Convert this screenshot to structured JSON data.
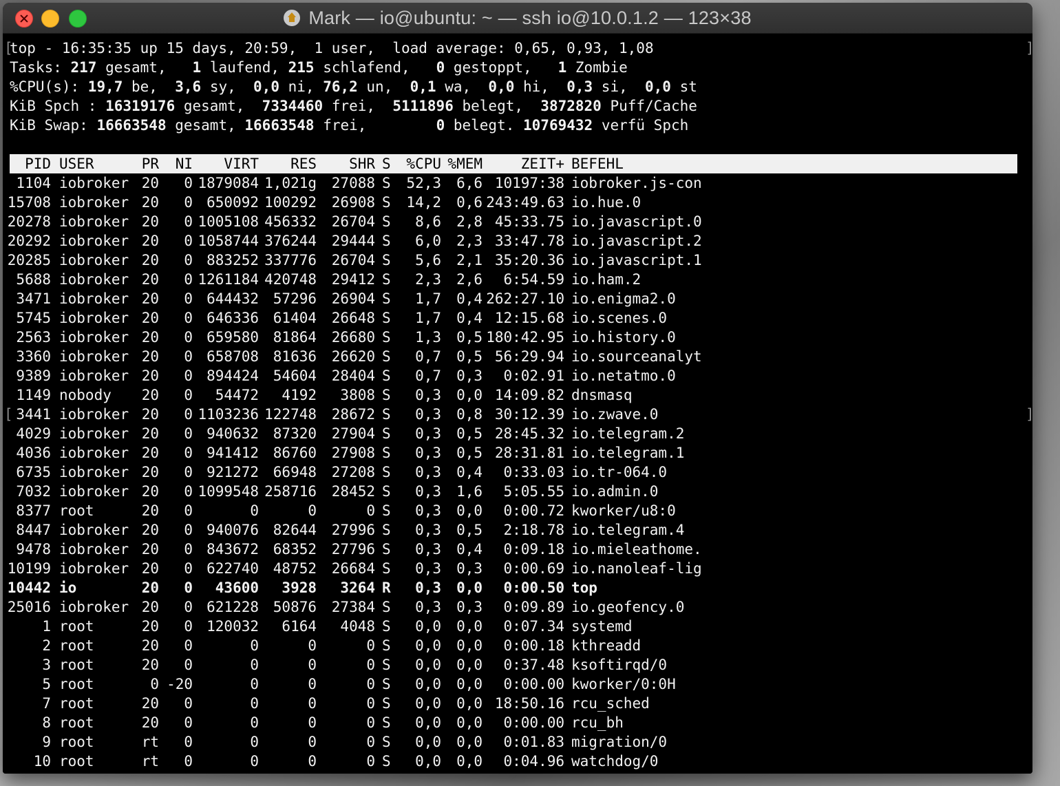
{
  "window": {
    "title": "Mark — io@ubuntu: ~ — ssh io@10.0.1.2 — 123×38",
    "icon": "home-icon"
  },
  "summary": [
    {
      "parts": [
        {
          "t": "top - 16:35:35 up 15 days, 20:59,  1 user,  load average: 0,65, 0,93, 1,08",
          "b": false
        }
      ]
    },
    {
      "parts": [
        {
          "t": "Tasks: ",
          "b": false
        },
        {
          "t": "217",
          "b": true
        },
        {
          "t": " gesamt,   ",
          "b": false
        },
        {
          "t": "1",
          "b": true
        },
        {
          "t": " laufend, ",
          "b": false
        },
        {
          "t": "215",
          "b": true
        },
        {
          "t": " schlafend,   ",
          "b": false
        },
        {
          "t": "0",
          "b": true
        },
        {
          "t": " gestoppt,   ",
          "b": false
        },
        {
          "t": "1",
          "b": true
        },
        {
          "t": " Zombie",
          "b": false
        }
      ]
    },
    {
      "parts": [
        {
          "t": "%CPU(s): ",
          "b": false
        },
        {
          "t": "19,7",
          "b": true
        },
        {
          "t": " be,  ",
          "b": false
        },
        {
          "t": "3,6",
          "b": true
        },
        {
          "t": " sy,  ",
          "b": false
        },
        {
          "t": "0,0",
          "b": true
        },
        {
          "t": " ni, ",
          "b": false
        },
        {
          "t": "76,2",
          "b": true
        },
        {
          "t": " un,  ",
          "b": false
        },
        {
          "t": "0,1",
          "b": true
        },
        {
          "t": " wa,  ",
          "b": false
        },
        {
          "t": "0,0",
          "b": true
        },
        {
          "t": " hi,  ",
          "b": false
        },
        {
          "t": "0,3",
          "b": true
        },
        {
          "t": " si,  ",
          "b": false
        },
        {
          "t": "0,0",
          "b": true
        },
        {
          "t": " st",
          "b": false
        }
      ]
    },
    {
      "parts": [
        {
          "t": "KiB Spch : ",
          "b": false
        },
        {
          "t": "16319176",
          "b": true
        },
        {
          "t": " gesamt,  ",
          "b": false
        },
        {
          "t": "7334460",
          "b": true
        },
        {
          "t": " frei,  ",
          "b": false
        },
        {
          "t": "5111896",
          "b": true
        },
        {
          "t": " belegt,  ",
          "b": false
        },
        {
          "t": "3872820",
          "b": true
        },
        {
          "t": " Puff/Cache",
          "b": false
        }
      ]
    },
    {
      "parts": [
        {
          "t": "KiB Swap: ",
          "b": false
        },
        {
          "t": "16663548",
          "b": true
        },
        {
          "t": " gesamt, ",
          "b": false
        },
        {
          "t": "16663548",
          "b": true
        },
        {
          "t": " frei,        ",
          "b": false
        },
        {
          "t": "0",
          "b": true
        },
        {
          "t": " belegt. ",
          "b": false
        },
        {
          "t": "10769432",
          "b": true
        },
        {
          "t": " verfü Spch",
          "b": false
        }
      ]
    }
  ],
  "columns": [
    "PID",
    "USER",
    "PR",
    "NI",
    "VIRT",
    "RES",
    "SHR",
    "S",
    "%CPU",
    "%MEM",
    "ZEIT+",
    "BEFEHL"
  ],
  "processes": [
    {
      "pid": "1104",
      "user": "iobroker",
      "pr": "20",
      "ni": "0",
      "virt": "1879084",
      "res": "1,021g",
      "shr": "27088",
      "s": "S",
      "cpu": "52,3",
      "mem": "6,6",
      "time": "10197:38",
      "cmd": "iobroker.js-con"
    },
    {
      "pid": "15708",
      "user": "iobroker",
      "pr": "20",
      "ni": "0",
      "virt": "650092",
      "res": "100292",
      "shr": "26908",
      "s": "S",
      "cpu": "14,2",
      "mem": "0,6",
      "time": "243:49.63",
      "cmd": "io.hue.0"
    },
    {
      "pid": "20278",
      "user": "iobroker",
      "pr": "20",
      "ni": "0",
      "virt": "1005108",
      "res": "456332",
      "shr": "26704",
      "s": "S",
      "cpu": "8,6",
      "mem": "2,8",
      "time": "45:33.75",
      "cmd": "io.javascript.0"
    },
    {
      "pid": "20292",
      "user": "iobroker",
      "pr": "20",
      "ni": "0",
      "virt": "1058744",
      "res": "376244",
      "shr": "29444",
      "s": "S",
      "cpu": "6,0",
      "mem": "2,3",
      "time": "33:47.78",
      "cmd": "io.javascript.2"
    },
    {
      "pid": "20285",
      "user": "iobroker",
      "pr": "20",
      "ni": "0",
      "virt": "883252",
      "res": "337776",
      "shr": "26704",
      "s": "S",
      "cpu": "5,6",
      "mem": "2,1",
      "time": "35:20.36",
      "cmd": "io.javascript.1"
    },
    {
      "pid": "5688",
      "user": "iobroker",
      "pr": "20",
      "ni": "0",
      "virt": "1261184",
      "res": "420748",
      "shr": "29412",
      "s": "S",
      "cpu": "2,3",
      "mem": "2,6",
      "time": "6:54.59",
      "cmd": "io.ham.2"
    },
    {
      "pid": "3471",
      "user": "iobroker",
      "pr": "20",
      "ni": "0",
      "virt": "644432",
      "res": "57296",
      "shr": "26904",
      "s": "S",
      "cpu": "1,7",
      "mem": "0,4",
      "time": "262:27.10",
      "cmd": "io.enigma2.0"
    },
    {
      "pid": "5745",
      "user": "iobroker",
      "pr": "20",
      "ni": "0",
      "virt": "646336",
      "res": "61404",
      "shr": "26648",
      "s": "S",
      "cpu": "1,7",
      "mem": "0,4",
      "time": "12:15.68",
      "cmd": "io.scenes.0"
    },
    {
      "pid": "2563",
      "user": "iobroker",
      "pr": "20",
      "ni": "0",
      "virt": "659580",
      "res": "81864",
      "shr": "26680",
      "s": "S",
      "cpu": "1,3",
      "mem": "0,5",
      "time": "180:42.95",
      "cmd": "io.history.0"
    },
    {
      "pid": "3360",
      "user": "iobroker",
      "pr": "20",
      "ni": "0",
      "virt": "658708",
      "res": "81636",
      "shr": "26620",
      "s": "S",
      "cpu": "0,7",
      "mem": "0,5",
      "time": "56:29.94",
      "cmd": "io.sourceanalyt"
    },
    {
      "pid": "9389",
      "user": "iobroker",
      "pr": "20",
      "ni": "0",
      "virt": "894424",
      "res": "54604",
      "shr": "28404",
      "s": "S",
      "cpu": "0,7",
      "mem": "0,3",
      "time": "0:02.91",
      "cmd": "io.netatmo.0"
    },
    {
      "pid": "1149",
      "user": "nobody",
      "pr": "20",
      "ni": "0",
      "virt": "54472",
      "res": "4192",
      "shr": "3808",
      "s": "S",
      "cpu": "0,3",
      "mem": "0,0",
      "time": "14:09.82",
      "cmd": "dnsmasq"
    },
    {
      "pid": "3441",
      "user": "iobroker",
      "pr": "20",
      "ni": "0",
      "virt": "1103236",
      "res": "122748",
      "shr": "28672",
      "s": "S",
      "cpu": "0,3",
      "mem": "0,8",
      "time": "30:12.39",
      "cmd": "io.zwave.0"
    },
    {
      "pid": "4029",
      "user": "iobroker",
      "pr": "20",
      "ni": "0",
      "virt": "940632",
      "res": "87320",
      "shr": "27904",
      "s": "S",
      "cpu": "0,3",
      "mem": "0,5",
      "time": "28:45.32",
      "cmd": "io.telegram.2"
    },
    {
      "pid": "4036",
      "user": "iobroker",
      "pr": "20",
      "ni": "0",
      "virt": "941412",
      "res": "86760",
      "shr": "27908",
      "s": "S",
      "cpu": "0,3",
      "mem": "0,5",
      "time": "28:31.81",
      "cmd": "io.telegram.1"
    },
    {
      "pid": "6735",
      "user": "iobroker",
      "pr": "20",
      "ni": "0",
      "virt": "921272",
      "res": "66948",
      "shr": "27208",
      "s": "S",
      "cpu": "0,3",
      "mem": "0,4",
      "time": "0:33.03",
      "cmd": "io.tr-064.0"
    },
    {
      "pid": "7032",
      "user": "iobroker",
      "pr": "20",
      "ni": "0",
      "virt": "1099548",
      "res": "258716",
      "shr": "28452",
      "s": "S",
      "cpu": "0,3",
      "mem": "1,6",
      "time": "5:05.55",
      "cmd": "io.admin.0"
    },
    {
      "pid": "8377",
      "user": "root",
      "pr": "20",
      "ni": "0",
      "virt": "0",
      "res": "0",
      "shr": "0",
      "s": "S",
      "cpu": "0,3",
      "mem": "0,0",
      "time": "0:00.72",
      "cmd": "kworker/u8:0"
    },
    {
      "pid": "8447",
      "user": "iobroker",
      "pr": "20",
      "ni": "0",
      "virt": "940076",
      "res": "82644",
      "shr": "27996",
      "s": "S",
      "cpu": "0,3",
      "mem": "0,5",
      "time": "2:18.78",
      "cmd": "io.telegram.4"
    },
    {
      "pid": "9478",
      "user": "iobroker",
      "pr": "20",
      "ni": "0",
      "virt": "843672",
      "res": "68352",
      "shr": "27796",
      "s": "S",
      "cpu": "0,3",
      "mem": "0,4",
      "time": "0:09.18",
      "cmd": "io.mieleathome."
    },
    {
      "pid": "10199",
      "user": "iobroker",
      "pr": "20",
      "ni": "0",
      "virt": "622740",
      "res": "48752",
      "shr": "26684",
      "s": "S",
      "cpu": "0,3",
      "mem": "0,3",
      "time": "0:00.69",
      "cmd": "io.nanoleaf-lig"
    },
    {
      "pid": "10442",
      "user": "io",
      "pr": "20",
      "ni": "0",
      "virt": "43600",
      "res": "3928",
      "shr": "3264",
      "s": "R",
      "cpu": "0,3",
      "mem": "0,0",
      "time": "0:00.50",
      "cmd": "top",
      "bold": true
    },
    {
      "pid": "25016",
      "user": "iobroker",
      "pr": "20",
      "ni": "0",
      "virt": "621228",
      "res": "50876",
      "shr": "27384",
      "s": "S",
      "cpu": "0,3",
      "mem": "0,3",
      "time": "0:09.89",
      "cmd": "io.geofency.0"
    },
    {
      "pid": "1",
      "user": "root",
      "pr": "20",
      "ni": "0",
      "virt": "120032",
      "res": "6164",
      "shr": "4048",
      "s": "S",
      "cpu": "0,0",
      "mem": "0,0",
      "time": "0:07.34",
      "cmd": "systemd"
    },
    {
      "pid": "2",
      "user": "root",
      "pr": "20",
      "ni": "0",
      "virt": "0",
      "res": "0",
      "shr": "0",
      "s": "S",
      "cpu": "0,0",
      "mem": "0,0",
      "time": "0:00.18",
      "cmd": "kthreadd"
    },
    {
      "pid": "3",
      "user": "root",
      "pr": "20",
      "ni": "0",
      "virt": "0",
      "res": "0",
      "shr": "0",
      "s": "S",
      "cpu": "0,0",
      "mem": "0,0",
      "time": "0:37.48",
      "cmd": "ksoftirqd/0"
    },
    {
      "pid": "5",
      "user": "root",
      "pr": "0",
      "ni": "-20",
      "virt": "0",
      "res": "0",
      "shr": "0",
      "s": "S",
      "cpu": "0,0",
      "mem": "0,0",
      "time": "0:00.00",
      "cmd": "kworker/0:0H"
    },
    {
      "pid": "7",
      "user": "root",
      "pr": "20",
      "ni": "0",
      "virt": "0",
      "res": "0",
      "shr": "0",
      "s": "S",
      "cpu": "0,0",
      "mem": "0,0",
      "time": "18:50.16",
      "cmd": "rcu_sched"
    },
    {
      "pid": "8",
      "user": "root",
      "pr": "20",
      "ni": "0",
      "virt": "0",
      "res": "0",
      "shr": "0",
      "s": "S",
      "cpu": "0,0",
      "mem": "0,0",
      "time": "0:00.00",
      "cmd": "rcu_bh"
    },
    {
      "pid": "9",
      "user": "root",
      "pr": "rt",
      "ni": "0",
      "virt": "0",
      "res": "0",
      "shr": "0",
      "s": "S",
      "cpu": "0,0",
      "mem": "0,0",
      "time": "0:01.83",
      "cmd": "migration/0"
    },
    {
      "pid": "10",
      "user": "root",
      "pr": "rt",
      "ni": "0",
      "virt": "0",
      "res": "0",
      "shr": "0",
      "s": "S",
      "cpu": "0,0",
      "mem": "0,0",
      "time": "0:04.96",
      "cmd": "watchdog/0"
    }
  ]
}
